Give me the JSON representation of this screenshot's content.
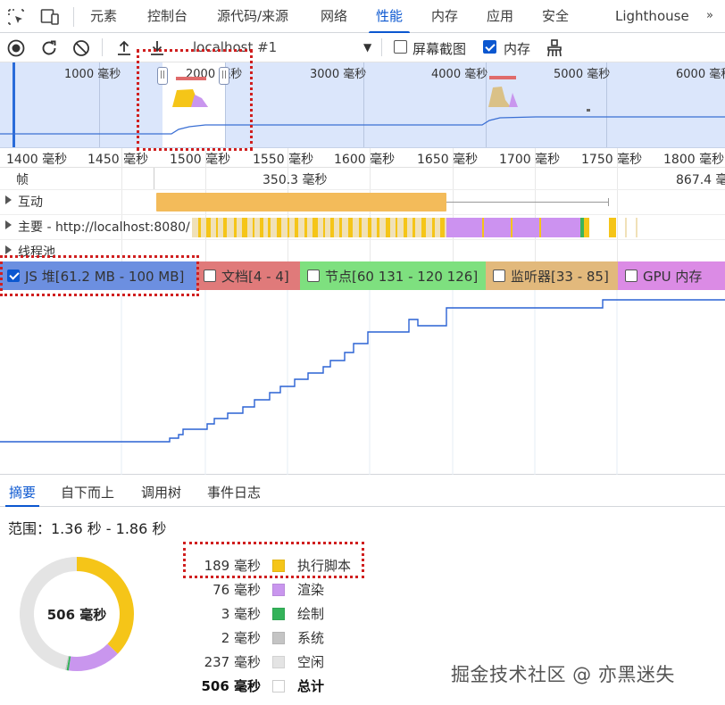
{
  "tabs": [
    "元素",
    "控制台",
    "源代码/来源",
    "网络",
    "性能",
    "内存",
    "应用",
    "安全",
    "Lighthouse"
  ],
  "active_tab": "性能",
  "toolbar": {
    "target": "localhost #1",
    "screenshots_label": "屏幕截图",
    "memory_label": "内存"
  },
  "overview": {
    "ticks": [
      "1000 毫秒",
      "2000 毫秒",
      "3000 毫秒",
      "4000 毫秒",
      "5000 毫秒",
      "6000 毫秒"
    ]
  },
  "ruler": [
    "1400 毫秒",
    "1450 毫秒",
    "1500 毫秒",
    "1550 毫秒",
    "1600 毫秒",
    "1650 毫秒",
    "1700 毫秒",
    "1750 毫秒",
    "1800 毫秒"
  ],
  "tracks": {
    "frames_label": "帧",
    "frame_1": "350.3 毫秒",
    "frame_2": "867.4 毫",
    "interactions_label": "互动",
    "main_label": "主要 - http://localhost:8080/",
    "threadpool_label": "线程池"
  },
  "memory_legend": [
    {
      "label": "JS 堆[61.2 MB - 100 MB]",
      "checked": true,
      "color": "#6c8fe0"
    },
    {
      "label": "文档[4 - 4]",
      "checked": false,
      "color": "#e07a7a"
    },
    {
      "label": "节点[60 131 - 120 126]",
      "checked": false,
      "color": "#7ee07f"
    },
    {
      "label": "监听器[33 - 85]",
      "checked": false,
      "color": "#e2b97c"
    },
    {
      "label": "GPU 内存",
      "checked": false,
      "color": "#db8be5"
    }
  ],
  "bottom_tabs": [
    "摘要",
    "自下而上",
    "调用树",
    "事件日志"
  ],
  "summary": {
    "range": "范围：1.36 秒 - 1.86 秒",
    "total_center": "506 毫秒",
    "rows": [
      {
        "value": "189 毫秒",
        "name": "执行脚本",
        "color": "#f5c518"
      },
      {
        "value": "76 毫秒",
        "name": "渲染",
        "color": "#c996ee"
      },
      {
        "value": "3 毫秒",
        "name": "绘制",
        "color": "#34b35a"
      },
      {
        "value": "2 毫秒",
        "name": "系统",
        "color": "#c4c4c4"
      },
      {
        "value": "237 毫秒",
        "name": "空闲",
        "color": "#e4e4e4"
      },
      {
        "value": "506 毫秒",
        "name": "总计",
        "color": "#ffffff"
      }
    ]
  },
  "chart_data": {
    "type": "pie",
    "categories": [
      "执行脚本",
      "渲染",
      "绘制",
      "系统",
      "空闲"
    ],
    "values": [
      189,
      76,
      3,
      2,
      237
    ],
    "colors": [
      "#f5c518",
      "#c996ee",
      "#34b35a",
      "#c4c4c4",
      "#e4e4e4"
    ]
  },
  "watermark": "掘金技术社区 @ 亦黑迷失"
}
